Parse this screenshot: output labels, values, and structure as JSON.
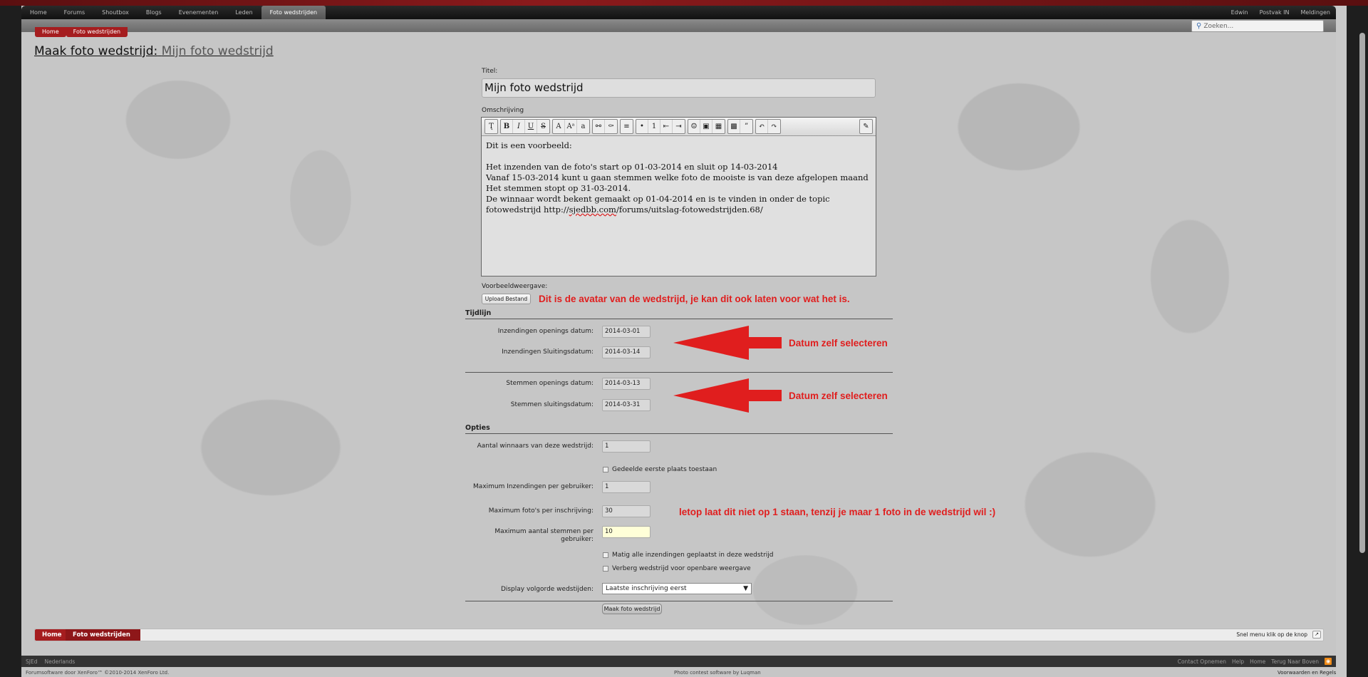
{
  "nav": {
    "tabs": [
      "Home",
      "Forums",
      "Shoutbox",
      "Blogs",
      "Evenementen",
      "Leden",
      "Foto wedstrijden"
    ],
    "active_tab": "Foto wedstrijden",
    "user": "Edwin",
    "inbox": "Postvak IN",
    "alerts": "Meldingen"
  },
  "search": {
    "placeholder": "Zoeken..."
  },
  "breadcrumb_top": [
    "Home",
    "Foto wedstrijden"
  ],
  "page": {
    "title_prefix": "Maak foto wedstrijd:",
    "title_link": "Mijn foto wedstrijd"
  },
  "form": {
    "title_label": "Titel:",
    "title_value": "Mijn foto wedstrijd",
    "description_label": "Omschrijving",
    "description_lines": [
      "Dit is een voorbeeld:",
      "",
      "Het inzenden van de foto's start op 01-03-2014 en sluit op 14-03-2014",
      "Vanaf 15-03-2014 kunt u gaan stemmen welke foto de mooiste is van deze afgelopen maand",
      "Het stemmen stopt op 31-03-2014.",
      "De winnaar wordt bekent gemaakt op 01-04-2014 en is te vinden in onder de topic",
      "fotowedstrijd http://",
      "sjedbb.com",
      "/forums/uitslag-fotowedstrijden.68/"
    ],
    "preview_label": "Voorbeeldweergave:",
    "upload_label": "Upload Bestand",
    "timeline_heading": "Tijdlijn",
    "entry_open_label": "Inzendingen openings datum:",
    "entry_open_value": "2014-03-01",
    "entry_close_label": "Inzendingen Sluitingsdatum:",
    "entry_close_value": "2014-03-14",
    "vote_open_label": "Stemmen openings datum:",
    "vote_open_value": "2014-03-13",
    "vote_close_label": "Stemmen sluitingsdatum:",
    "vote_close_value": "2014-03-31",
    "options_heading": "Opties",
    "winners_label": "Aantal winnaars van deze wedstrijd:",
    "winners_value": "1",
    "shared_first_label": "Gedeelde eerste plaats toestaan",
    "max_entries_label": "Maximum Inzendingen per gebruiker:",
    "max_entries_value": "1",
    "max_photos_label": "Maximum foto's per inschrijving:",
    "max_photos_value": "30",
    "max_votes_label": "Maximum aantal stemmen per gebruiker:",
    "max_votes_value": "10",
    "moderate_label": "Matig alle inzendingen geplaatst in deze wedstrijd",
    "hide_label": "Verberg wedstrijd voor openbare weergave",
    "display_order_label": "Display volgorde wedstijden:",
    "display_order_value": "Laatste inschrijving eerst",
    "submit_label": "Maak foto wedstrijd"
  },
  "annotations": {
    "avatar": "Dit is de avatar van de wedstrijd, je kan dit ook laten voor wat het is.",
    "date1": "Datum zelf selecteren",
    "date2": "Datum zelf selecteren",
    "photos": "letop laat dit niet op 1 staan, tenzij je maar 1 foto in de wedstrijd wil :)"
  },
  "breadcrumb_bottom": [
    "Home",
    "Foto wedstrijden"
  ],
  "quick_menu": "Snel menu klik op de knop",
  "footer": {
    "left": [
      "SJEd",
      "Nederlands"
    ],
    "right": [
      "Contact Opnemen",
      "Help",
      "Home",
      "Terug Naar Boven"
    ]
  },
  "copyright": {
    "left": "Forumsoftware door XenForo™ ©2010-2014 XenForo Ltd.",
    "center": "Photo contest software by Luqman",
    "right": "Voorwaarden en Regels"
  },
  "colors": {
    "accent": "#a51d1f",
    "annotation": "#e01e1e"
  }
}
